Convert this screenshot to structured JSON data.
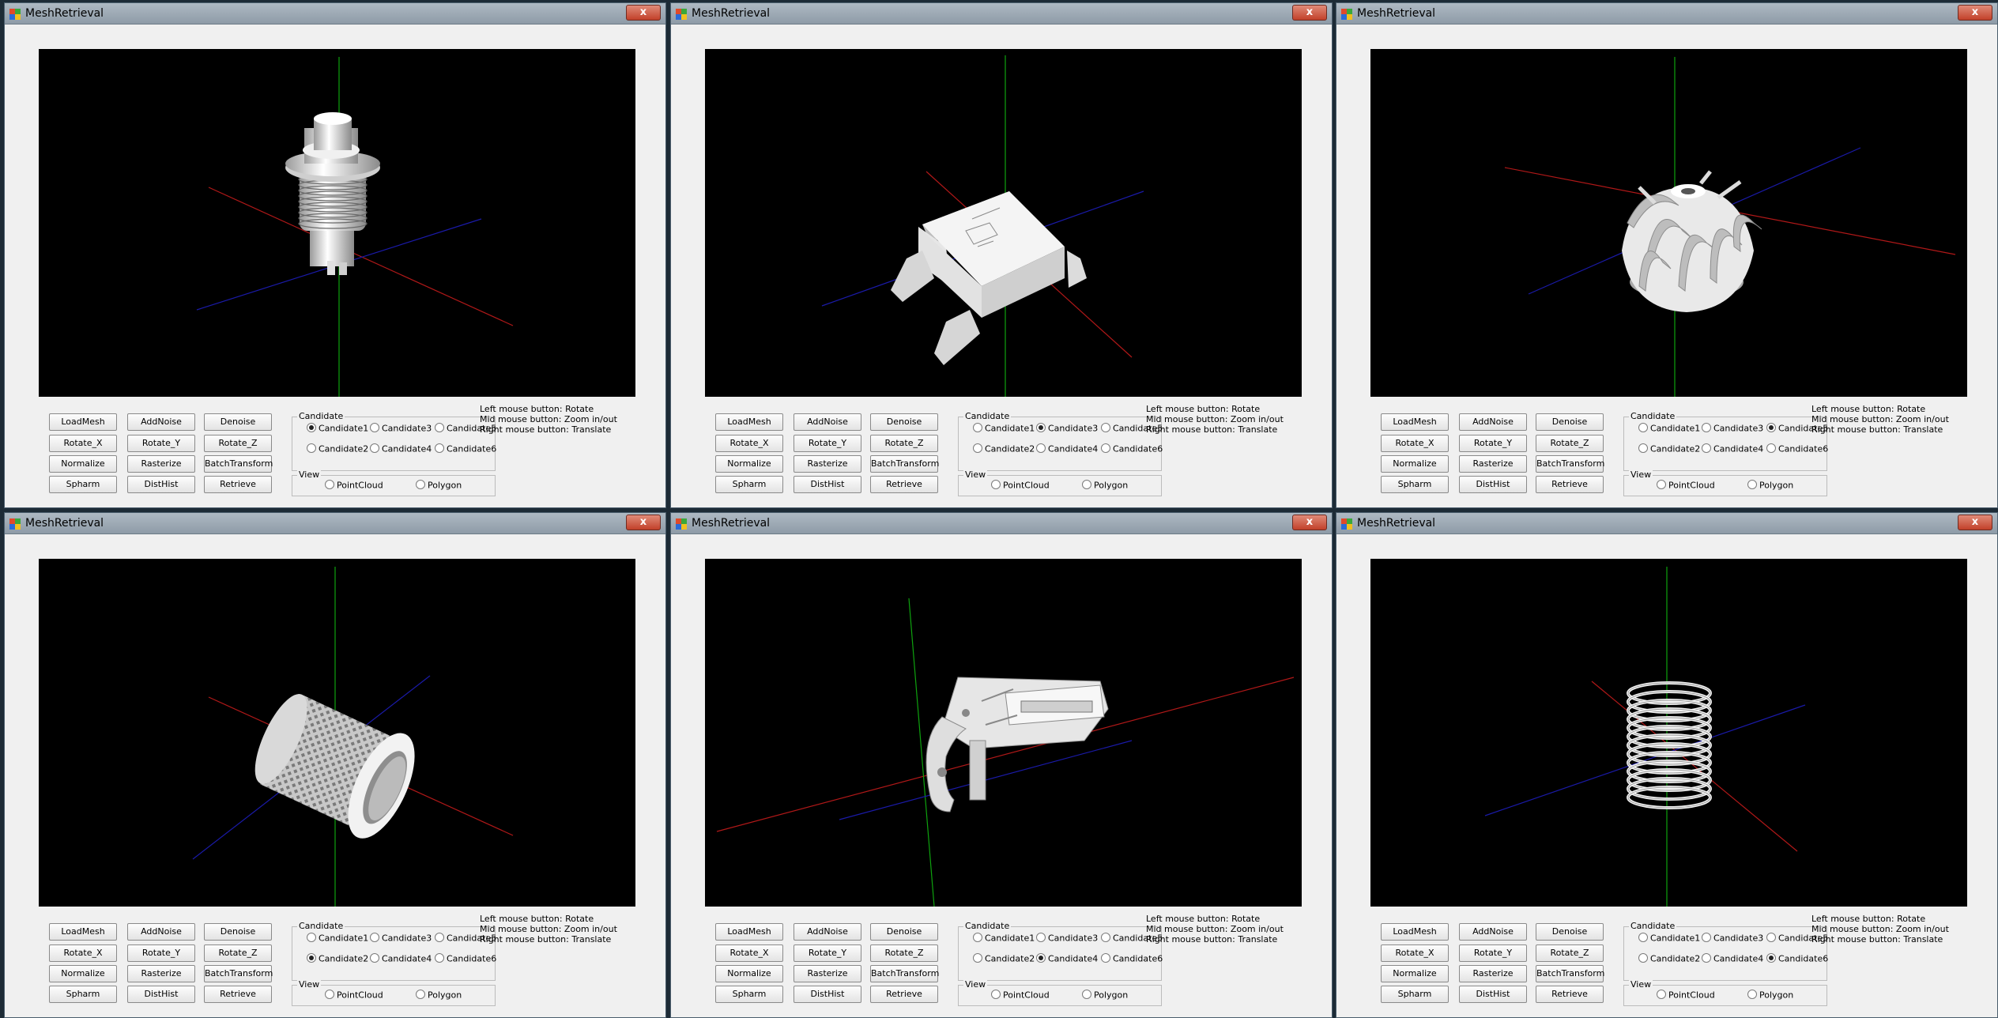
{
  "app_title": "MeshRetrieval",
  "close_glyph": "x",
  "buttons": {
    "load_mesh": "LoadMesh",
    "add_noise": "AddNoise",
    "denoise": "Denoise",
    "rotate_x": "Rotate_X",
    "rotate_y": "Rotate_Y",
    "rotate_z": "Rotate_Z",
    "normalize": "Normalize",
    "rasterize": "Rasterize",
    "batch_transform": "BatchTransform",
    "spharm": "Spharm",
    "dist_hist": "DistHist",
    "retrieve": "Retrieve"
  },
  "candidate_group_title": "Candidate",
  "candidates": [
    "Candidate1",
    "Candidate3",
    "Candidate5",
    "Candidate2",
    "Candidate4",
    "Candidate6"
  ],
  "view_group_title": "View",
  "view_options": [
    "PointCloud",
    "Polygon"
  ],
  "help_lines": [
    "Left mouse button: Rotate",
    "Mid mouse button: Zoom in/out",
    "Right mouse button: Translate"
  ],
  "windows": [
    {
      "selected_candidate": "Candidate1",
      "model": "push-button-switch"
    },
    {
      "selected_candidate": "Candidate3",
      "model": "smd-chip-component"
    },
    {
      "selected_candidate": "Candidate5",
      "model": "turbine-impeller"
    },
    {
      "selected_candidate": "Candidate2",
      "model": "knurled-cylinder"
    },
    {
      "selected_candidate": "Candidate4",
      "model": "gripper-mechanism"
    },
    {
      "selected_candidate": "Candidate6",
      "model": "coil-spring"
    }
  ],
  "colors": {
    "viewport_bg": "#000000",
    "axis_red": "#b01818",
    "axis_green": "#0ea20e",
    "axis_blue": "#1a1aa8",
    "model_fill": "#d8d8d8"
  }
}
